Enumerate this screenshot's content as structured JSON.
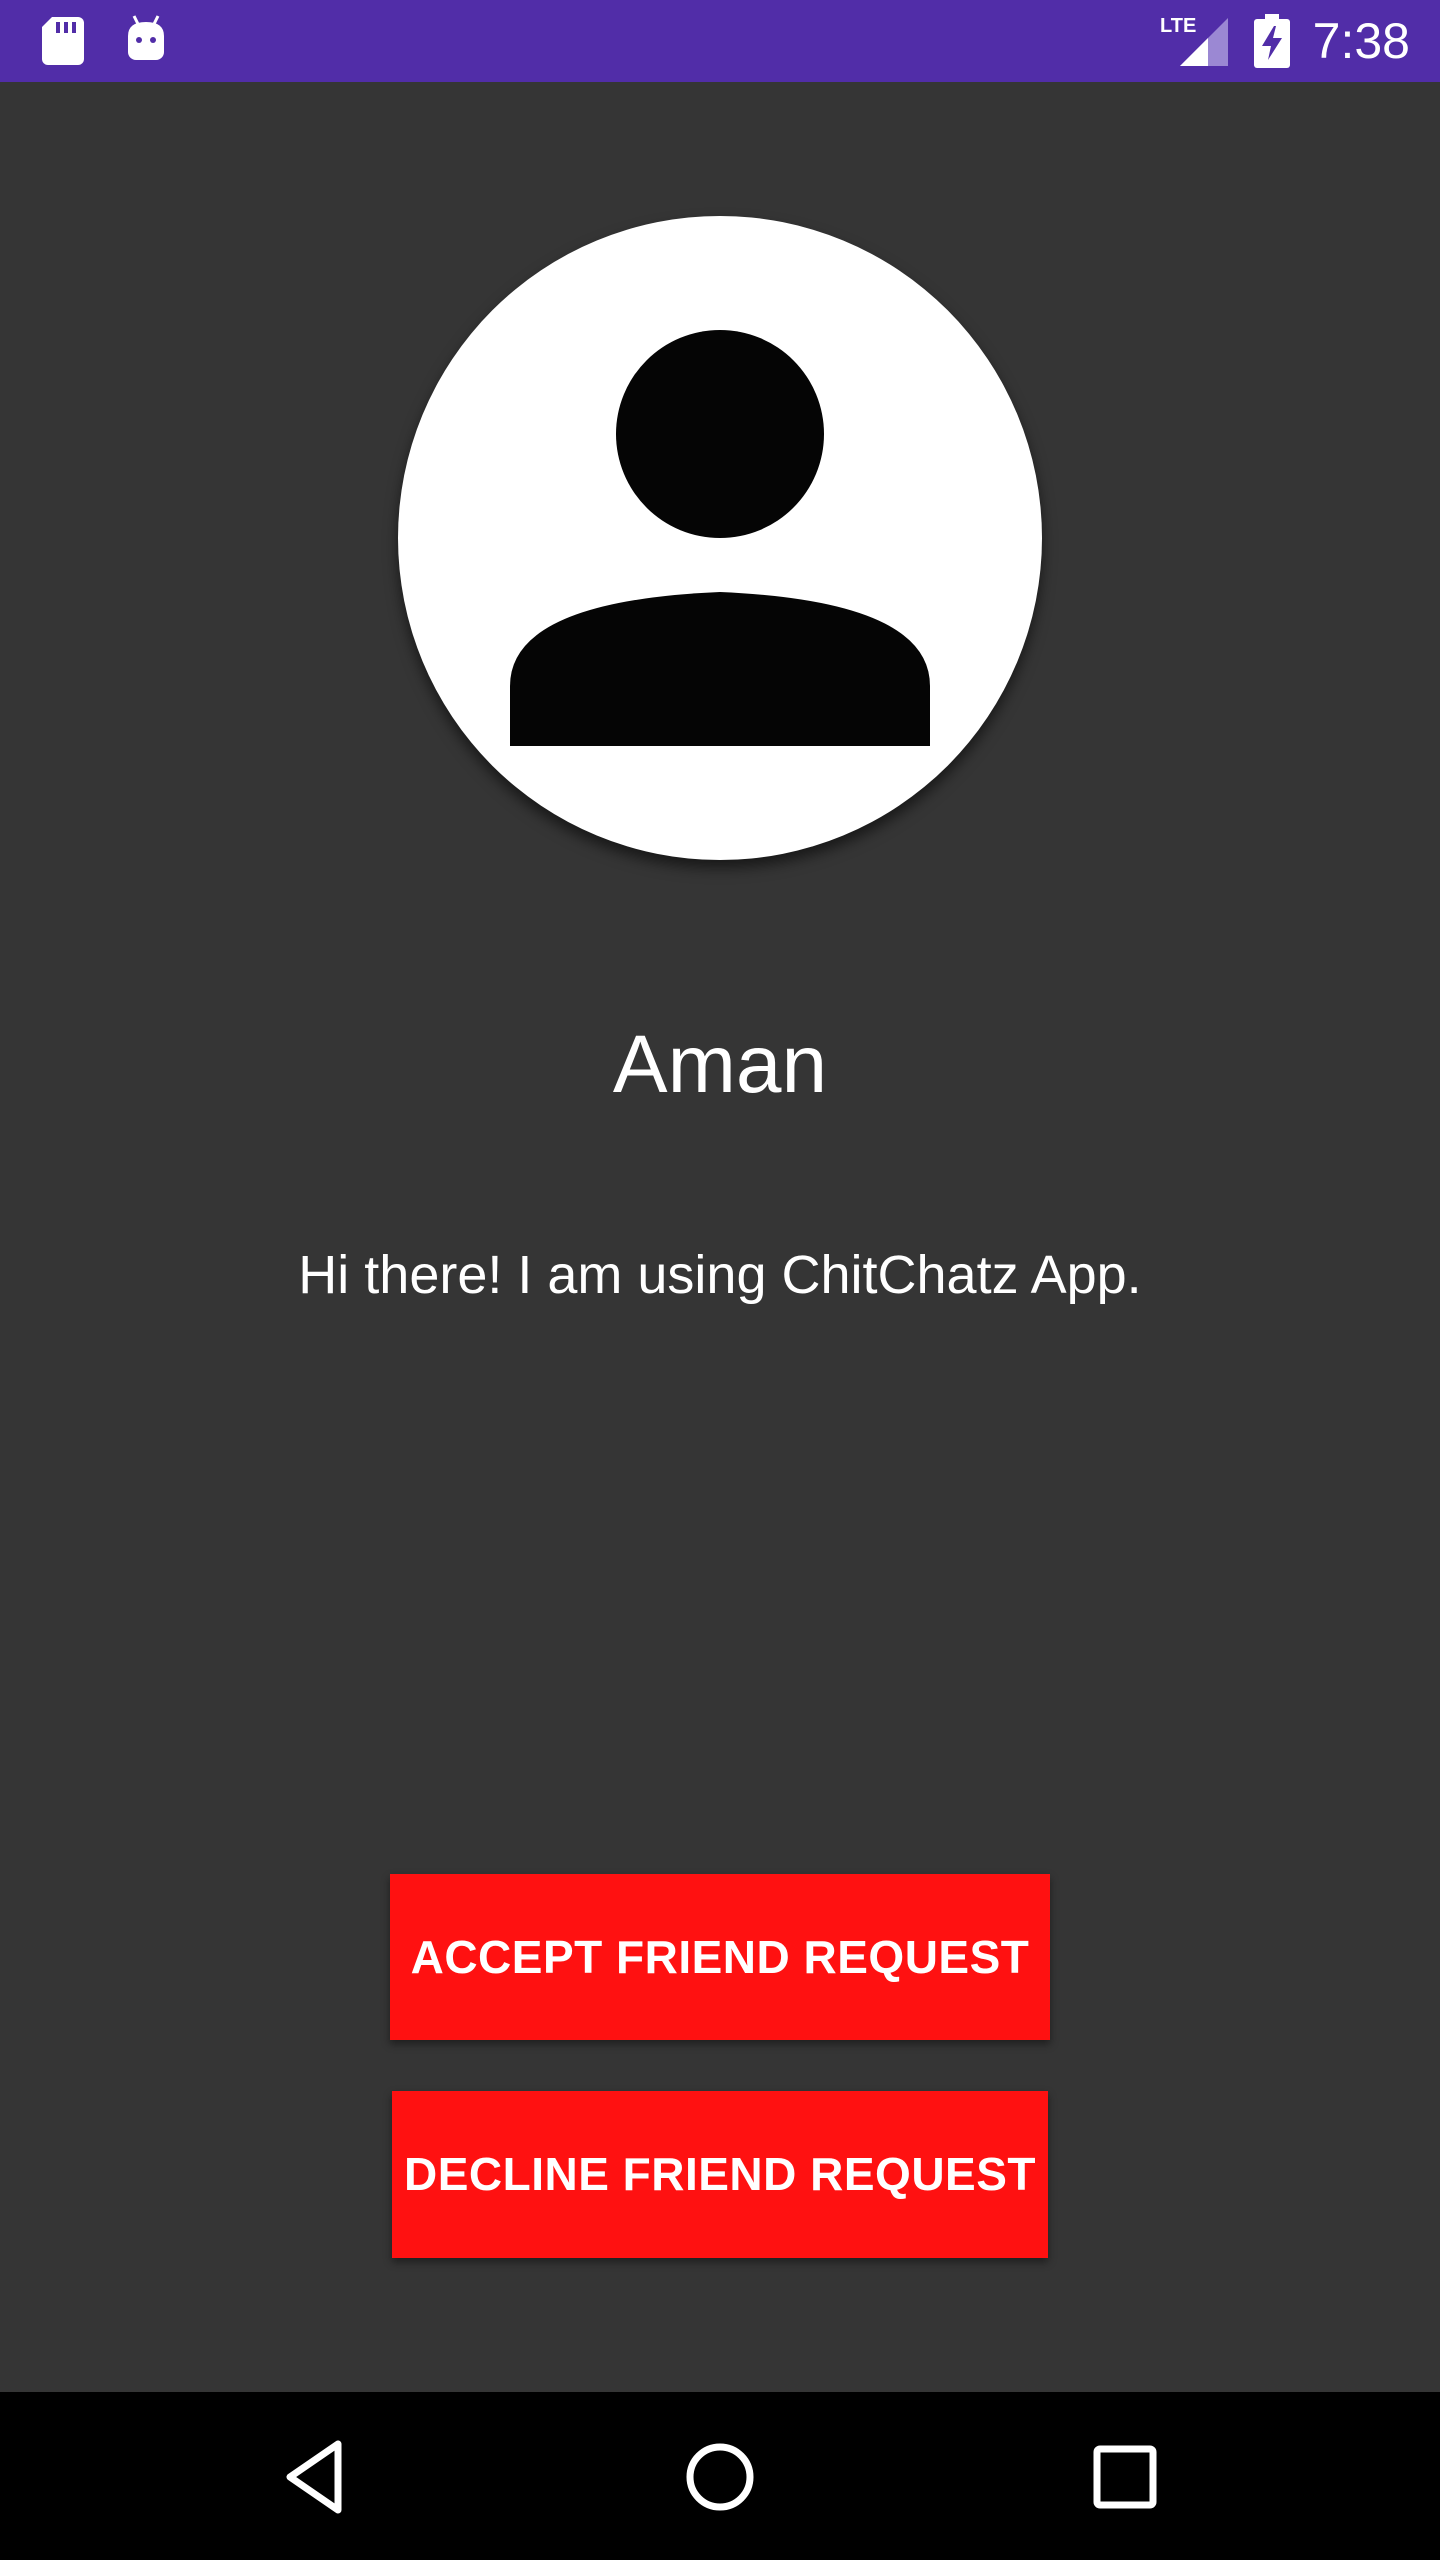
{
  "status_bar": {
    "time": "7:38",
    "network": "LTE",
    "background_color": "#512da8",
    "icons": [
      "sd-card-icon",
      "android-debug-icon",
      "lte-signal-icon",
      "battery-charging-icon"
    ]
  },
  "profile": {
    "avatar_icon": "default-person-icon",
    "name": "Aman",
    "status": "Hi there! I am using ChitChatz App."
  },
  "actions": {
    "accept_label": "ACCEPT FRIEND REQUEST",
    "decline_label": "DECLINE FRIEND REQUEST",
    "button_color": "#ff1111"
  },
  "nav_bar": {
    "icons": [
      "back-icon",
      "home-icon",
      "recents-icon"
    ]
  },
  "theme": {
    "background": "#353535"
  }
}
